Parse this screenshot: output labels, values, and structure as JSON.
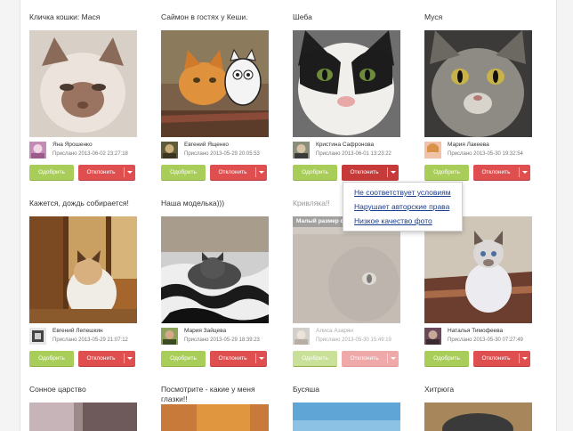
{
  "approve_label": "Одобрить",
  "reject_label": "Отклонить",
  "sent_prefix": "Прислано",
  "small_size_label": "Малый размер ф",
  "dropdown": [
    "Не соответствует условиям",
    "Нарушает авторские права",
    "Низкое качество фото"
  ],
  "cards": [
    {
      "title": "Кличка кошки: Мася",
      "user": "Яна Ярошенко",
      "date": "2013-06-02 23:27:18"
    },
    {
      "title": "Саймон в гостях у Кеши.",
      "user": "Евгений Ященко",
      "date": "2013-05-29 20:05:53"
    },
    {
      "title": "Шеба",
      "user": "Кристина Сафронова",
      "date": "2013-06-01 13:23:22"
    },
    {
      "title": "Муся",
      "user": "Мария Лакеева",
      "date": "2013-05-30 19:32:54"
    },
    {
      "title": "Кажется, дождь собирается!",
      "user": "Евгений Лепешкин",
      "date": "2013-05-29 21:07:12"
    },
    {
      "title": "Наша моделька)))",
      "user": "Мария Зайцева",
      "date": "2013-05-29 18:39:23"
    },
    {
      "title": "Кривляка!!",
      "user": "Алиса Азарян",
      "date": "2013-05-30 15:49:19"
    },
    {
      "title": "",
      "user": "Наталья Тимофеева",
      "date": "2013-05-30 07:27:49"
    },
    {
      "title": "Сонное царство"
    },
    {
      "title": "Посмотрите - какие у меня глазки!!"
    },
    {
      "title": "Бусяша"
    },
    {
      "title": "Хитрюга"
    }
  ]
}
